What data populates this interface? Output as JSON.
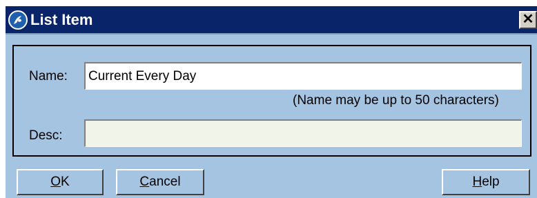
{
  "window": {
    "title": "List Item",
    "close_symbol": "✕"
  },
  "form": {
    "name_label": "Name:",
    "name_value": "Current Every Day",
    "name_hint": "(Name may be up to 50 characters)",
    "desc_label": "Desc:",
    "desc_value": ""
  },
  "buttons": {
    "ok": {
      "accel": "O",
      "rest": "K"
    },
    "cancel": {
      "accel": "C",
      "rest": "ancel"
    },
    "help": {
      "accel": "H",
      "rest": "elp"
    }
  },
  "icons": {
    "app": "app-logo-icon",
    "close": "close-icon"
  },
  "colors": {
    "titlebar": "#0a246a",
    "dialog_background": "#a4c4e2",
    "desc_field_background": "#f1f4e8"
  }
}
